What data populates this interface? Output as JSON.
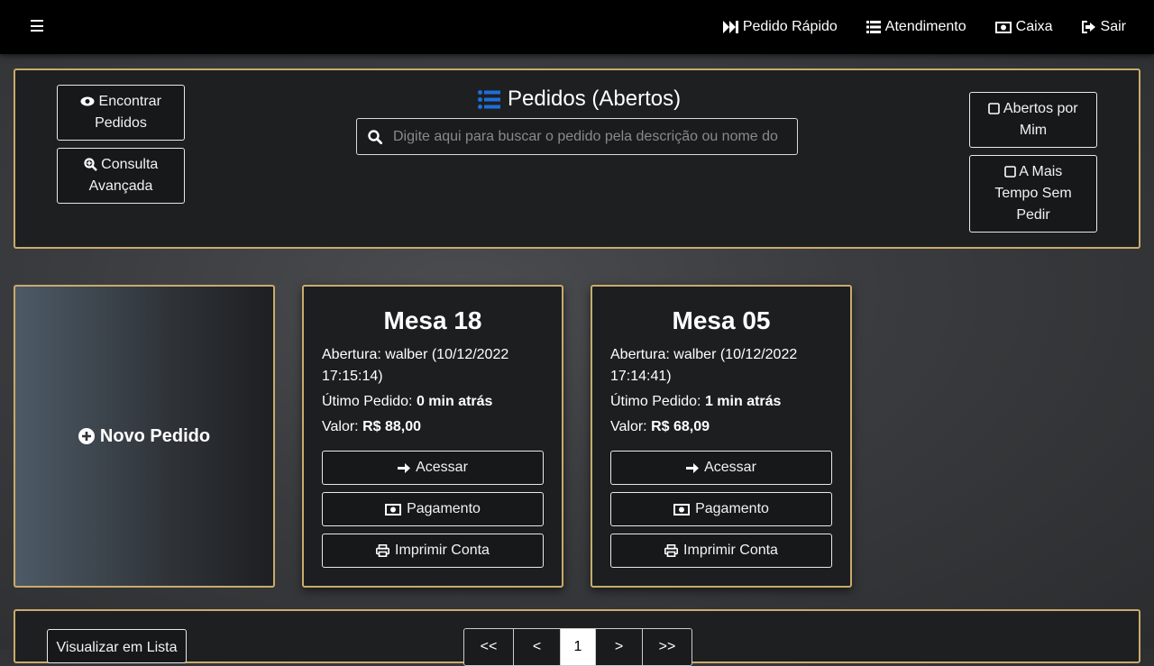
{
  "nav": {
    "quick_order": "Pedido Rápido",
    "service": "Atendimento",
    "cashier": "Caixa",
    "exit": "Sair"
  },
  "header": {
    "title": "Pedidos (Abertos)",
    "search_placeholder": "Digite aqui para buscar o pedido pela descrição ou nome do cliente",
    "find_orders_line1": "Encontrar",
    "find_orders_line2": "Pedidos",
    "advanced_line1": "Consulta",
    "advanced_line2": "Avançada",
    "opened_by_me_line1": "Abertos por",
    "opened_by_me_line2": "Mim",
    "longest_line1": "A Mais",
    "longest_line2": "Tempo Sem",
    "longest_line3": "Pedir"
  },
  "new_order": "Novo Pedido",
  "orders": [
    {
      "title": "Mesa 18",
      "opening_label": "Abertura:",
      "opening_value": "walber (10/12/2022 17:15:14)",
      "last_label": "Útimo Pedido:",
      "last_value": "0 min atrás",
      "value_label": "Valor:",
      "value": "R$ 88,00",
      "access": "Acessar",
      "payment": "Pagamento",
      "print": "Imprimir Conta"
    },
    {
      "title": "Mesa 05",
      "opening_label": "Abertura:",
      "opening_value": "walber (10/12/2022 17:14:41)",
      "last_label": "Útimo Pedido:",
      "last_value": "1 min atrás",
      "value_label": "Valor:",
      "value": "R$ 68,09",
      "access": "Acessar",
      "payment": "Pagamento",
      "print": "Imprimir Conta"
    }
  ],
  "footer": {
    "list_view": "Visualizar em Lista",
    "pages": [
      "<<",
      "<",
      "1",
      ">",
      ">>"
    ],
    "current_page": "1"
  },
  "colors": {
    "accent_border": "#c9ab6b",
    "title_icon": "#1e6fd9"
  },
  "icons": {
    "menu": "bars-icon",
    "quick": "fast-forward-icon",
    "service": "list-icon",
    "cashier": "money-icon",
    "exit": "sign-out-icon"
  }
}
